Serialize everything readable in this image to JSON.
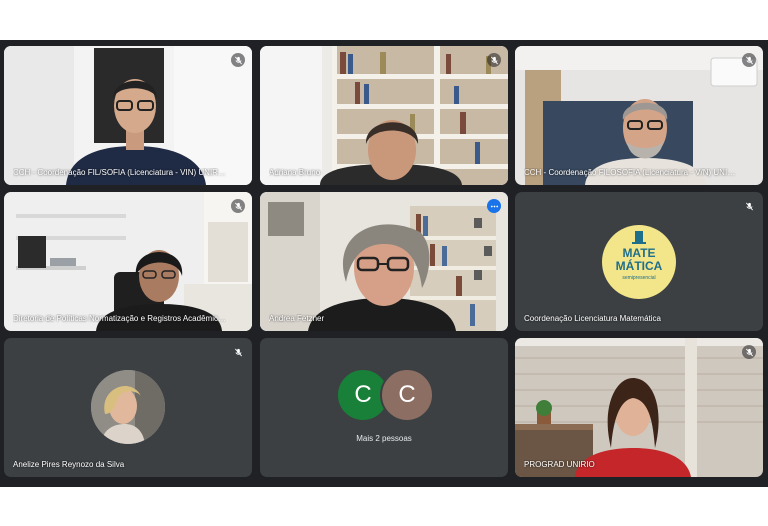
{
  "participants": [
    {
      "name": "CCH - Coordenação FIL/SOFIA (Licenciatura - VIN) UNIRIO",
      "muted": true
    },
    {
      "name": "Adriana Bruno",
      "muted": true
    },
    {
      "name": "CCH - Coordenação FILOSOFIA (Licenciatura - V/N) UNIRIO",
      "muted": true
    },
    {
      "name": "Diretoria de Políticas Normatização e Registros Acadêmico...",
      "muted": true
    },
    {
      "name": "Andrea Fetzner",
      "muted": false,
      "speaking": true
    },
    {
      "name": "Coordenação Licenciatura Matemática",
      "muted": true,
      "logo": {
        "line1": "MATE",
        "line2": "MÁTICA",
        "line3": "semipresencial"
      }
    },
    {
      "name": "Anelize Pires Reynozo da Silva",
      "muted": true
    },
    {
      "name": "PROGRAD UNIRIO",
      "muted": true
    }
  ],
  "overflow": {
    "label": "Mais 2 pessoas",
    "avatars": [
      {
        "letter": "C",
        "color": "#188038"
      },
      {
        "letter": "C",
        "color": "#8d6e63"
      }
    ]
  },
  "colors": {
    "background": "#202124",
    "tile": "#3c4043",
    "accent": "#8ab4f8"
  },
  "icons": {
    "muted": "mic-off-icon",
    "options": "more-vert-icon"
  }
}
